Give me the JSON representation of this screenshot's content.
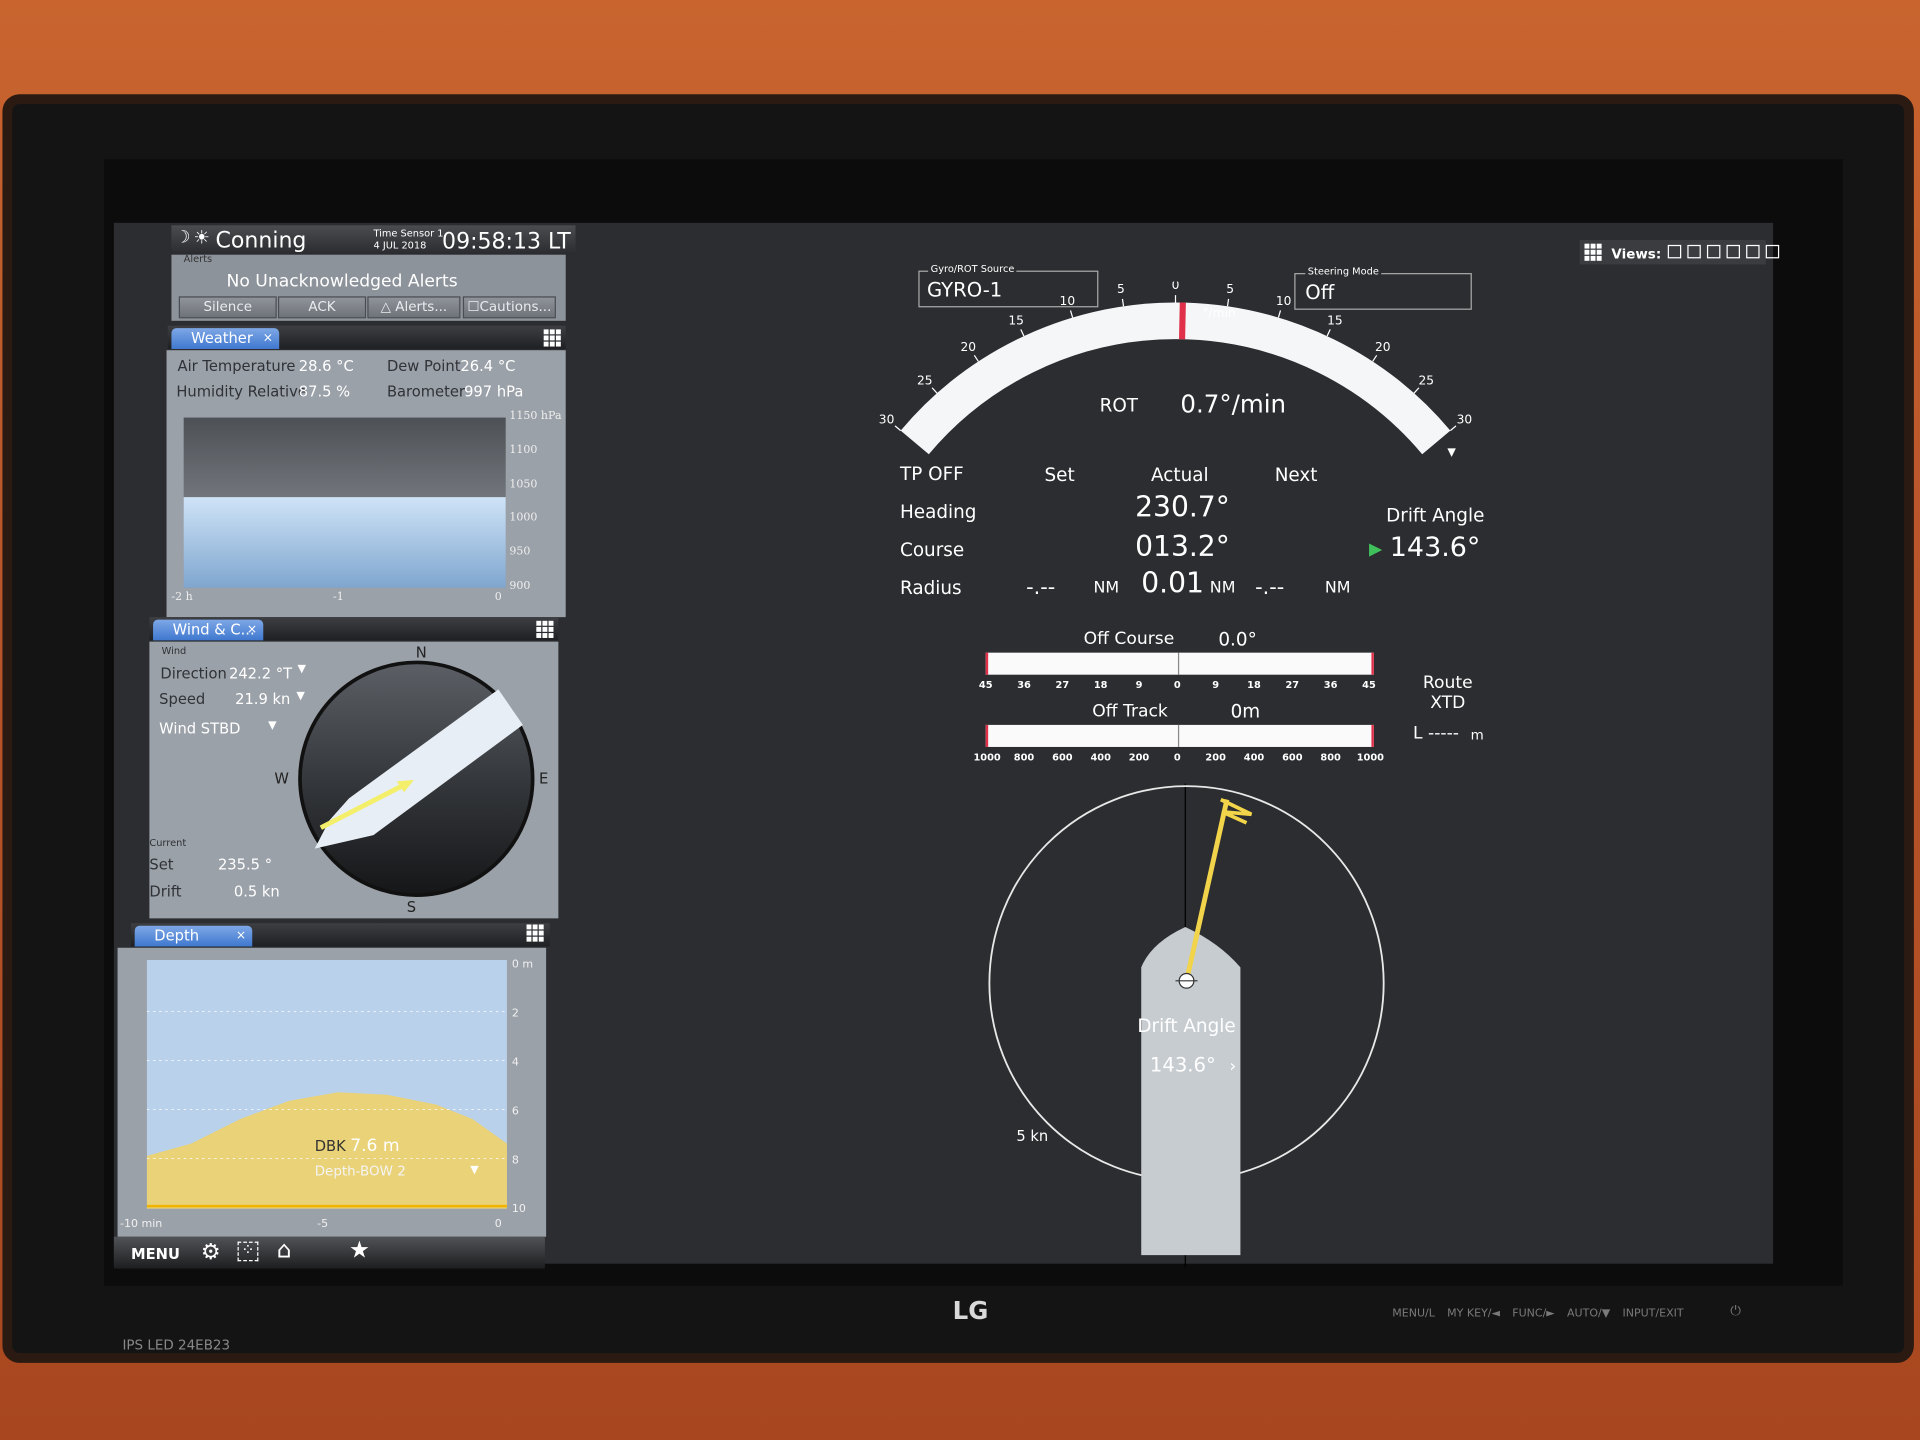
{
  "header": {
    "title": "Conning",
    "time_sensor_label": "Time Sensor 1",
    "date": "4 JUL 2018",
    "time": "09:58:13 LT",
    "views_label": "Views:"
  },
  "alerts": {
    "label": "Alerts",
    "status": "No Unacknowledged Alerts",
    "buttons": [
      "Silence",
      "ACK",
      "Alerts...",
      "Cautions..."
    ]
  },
  "weather": {
    "tab": "Weather",
    "air_temp_label": "Air Temperature",
    "air_temp": "28.6",
    "air_temp_unit": "°C",
    "dew_label": "Dew Point",
    "dew": "26.4",
    "dew_unit": "°C",
    "hum_label": "Humidity Relative",
    "hum": "87.5",
    "hum_unit": "%",
    "baro_label": "Barometer",
    "baro": "997",
    "baro_unit": "hPa",
    "chart": {
      "y_ticks": [
        "1150 hPa",
        "1100",
        "1050",
        "1000",
        "950",
        "900"
      ],
      "x_ticks": [
        "-2 h",
        "-1",
        "0"
      ],
      "value_hPa": 997
    }
  },
  "wind": {
    "tab": "Wind & C...",
    "wind_label": "Wind",
    "direction_label": "Direction",
    "direction": "242.2 °T",
    "speed_label": "Speed",
    "speed": "21.9 kn",
    "side": "Wind STBD",
    "current_label": "Current",
    "set_label": "Set",
    "set": "235.5 °",
    "drift_label": "Drift",
    "drift": "0.5 kn",
    "compass": [
      "N",
      "E",
      "S",
      "W"
    ],
    "wind_dir_deg": 242.2,
    "current_set_deg": 235.5
  },
  "depth": {
    "tab": "Depth",
    "dbk_label": "DBK",
    "dbk": "7.6 m",
    "source": "Depth-BOW 2",
    "y_ticks": [
      "0 m",
      "2",
      "4",
      "6",
      "8",
      "10"
    ],
    "x_ticks": [
      "-10 min",
      "-5",
      "0"
    ]
  },
  "toolbar": {
    "menu": "MENU",
    "icons": [
      "gear-icon",
      "screen-capture-icon",
      "home-icon",
      "star-icon"
    ]
  },
  "gyro": {
    "label": "Gyro/ROT Source",
    "value": "GYRO-1"
  },
  "steering": {
    "label": "Steering Mode",
    "value": "Off"
  },
  "rot": {
    "label": "ROT",
    "value": "0.7°/min",
    "unit": "°/min",
    "ticks": [
      "30",
      "25",
      "20",
      "15",
      "10",
      "5",
      "0",
      "5",
      "10",
      "15",
      "20",
      "25",
      "30"
    ],
    "range": 30,
    "reading": 0.7
  },
  "nav": {
    "tp": "TP OFF",
    "set": "Set",
    "actual": "Actual",
    "next": "Next",
    "heading_label": "Heading",
    "heading": "230.7°",
    "course_label": "Course",
    "course": "013.2°",
    "radius_label": "Radius",
    "radius_set": "-.--",
    "radius_actual": "0.01",
    "radius_next": "-.--",
    "nm": "NM",
    "drift_label": "Drift Angle",
    "drift": "143.6°"
  },
  "off_course": {
    "label": "Off Course",
    "value": "0.0°",
    "ticks": [
      "45",
      "36",
      "27",
      "18",
      "9",
      "0",
      "9",
      "18",
      "27",
      "36",
      "45"
    ]
  },
  "off_track": {
    "label": "Off Track",
    "value": "0m",
    "ticks": [
      "1000",
      "800",
      "600",
      "400",
      "200",
      "0",
      "200",
      "400",
      "600",
      "800",
      "1000"
    ]
  },
  "route_xtd": {
    "label1": "Route",
    "label2": "XTD",
    "value": "L -----",
    "unit": "m"
  },
  "ship_view": {
    "drift_label": "Drift Angle",
    "drift": "143.6°",
    "speed_scale": "5 kn"
  },
  "monitor": {
    "brand": "LG",
    "model": "IPS LED  24EB23",
    "buttons": [
      "MENU/L",
      "MY KEY/◄",
      "FUNC/►",
      "AUTO/▼",
      "INPUT/EXIT"
    ]
  },
  "colors": {
    "accent_tab": "#4f86d6",
    "rot_marker": "#e0304a",
    "yellow": "#f2d44a",
    "sea": "#b8d0e8",
    "ground": "#e8cf72"
  }
}
